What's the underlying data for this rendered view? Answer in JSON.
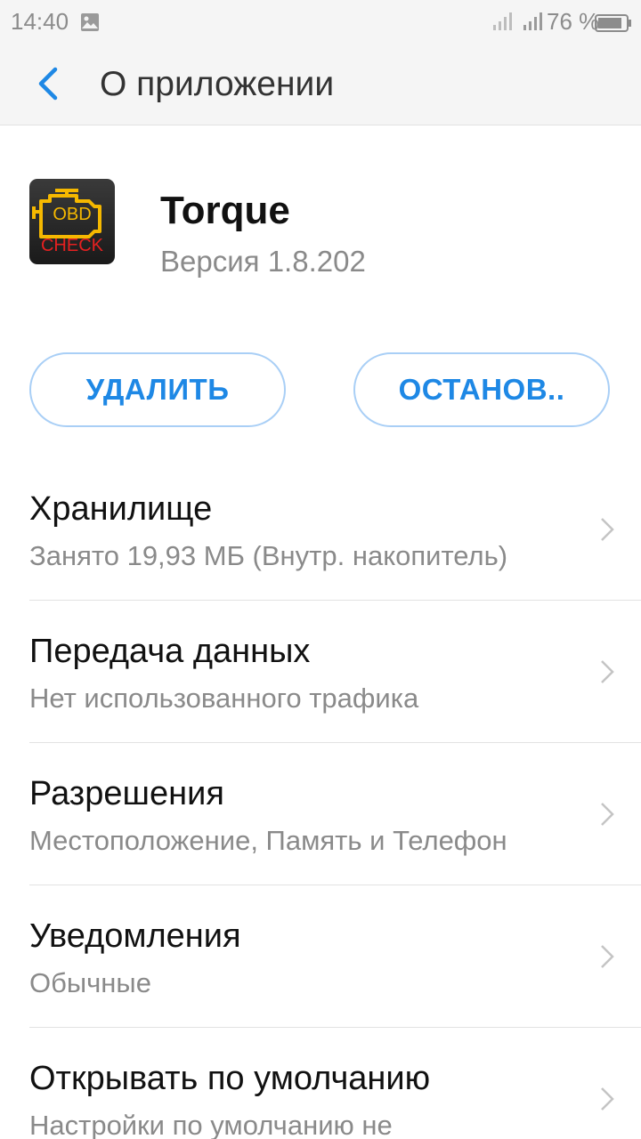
{
  "status_bar": {
    "time": "14:40",
    "battery_percent": "76 %",
    "icons": [
      "gallery-icon",
      "signal-icon",
      "signal-icon",
      "battery-icon"
    ]
  },
  "app_bar": {
    "back_icon": "chevron-left-icon",
    "title": "О приложении"
  },
  "app": {
    "icon": "obd-check-icon",
    "icon_text_top": "OBD",
    "icon_text_bottom": "CHECK",
    "name": "Torque",
    "version": "Версия 1.8.202"
  },
  "buttons": {
    "uninstall": "УДАЛИТЬ",
    "stop": "ОСТАНОВ.."
  },
  "items": [
    {
      "title": "Хранилище",
      "subtitle": "Занято 19,93 МБ (Внутр. накопитель)"
    },
    {
      "title": "Передача данных",
      "subtitle": "Нет использованного трафика"
    },
    {
      "title": "Разрешения",
      "subtitle": "Местоположение, Память и Телефон"
    },
    {
      "title": "Уведомления",
      "subtitle": "Обычные"
    },
    {
      "title": "Открывать по умолчанию",
      "subtitle": "Настройки по умолчанию не"
    }
  ],
  "colors": {
    "accent": "#1e88e5",
    "button_border": "#a9cff6",
    "secondary_text": "#8a8a8a",
    "icon_yellow": "#f5b800",
    "icon_red": "#e52020"
  }
}
